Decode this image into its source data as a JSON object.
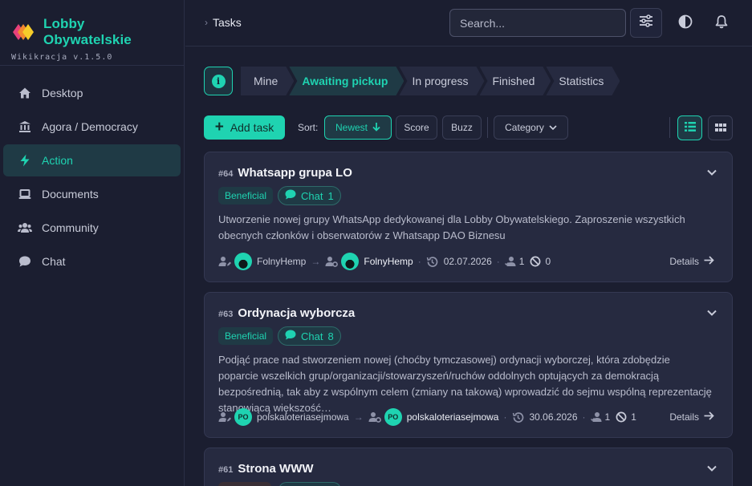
{
  "brand": {
    "name": "Lobby Obywatelskie",
    "version": "Wikikracja v.1.5.0"
  },
  "sidebar": {
    "items": [
      {
        "label": "Desktop",
        "icon": "home-icon"
      },
      {
        "label": "Agora / Democracy",
        "icon": "bank-icon"
      },
      {
        "label": "Action",
        "icon": "bolt-icon",
        "active": true
      },
      {
        "label": "Documents",
        "icon": "laptop-icon"
      },
      {
        "label": "Community",
        "icon": "users-icon"
      },
      {
        "label": "Chat",
        "icon": "chat-icon"
      }
    ]
  },
  "topbar": {
    "breadcrumb_sep": "›",
    "breadcrumb": "Tasks",
    "search_placeholder": "Search..."
  },
  "tabs": [
    {
      "label": "Mine"
    },
    {
      "label": "Awaiting pickup",
      "active": true
    },
    {
      "label": "In progress"
    },
    {
      "label": "Finished"
    },
    {
      "label": "Statistics"
    }
  ],
  "toolbar": {
    "add_label": "Add task",
    "sort_label": "Sort:",
    "sort_newest": "Newest",
    "sort_score": "Score",
    "sort_buzz": "Buzz",
    "category": "Category"
  },
  "tasks": [
    {
      "num": "#64",
      "title": "Whatsapp grupa LO",
      "tag": "Beneficial",
      "chat_label": "Chat",
      "chat_count": "1",
      "desc": "Utworzenie nowej grupy WhatsApp dedykowanej dla Lobby Obywatelskiego. Zaproszenie wszystkich obecnych członków i obserwatorów z  Whatsapp DAO Biznesu",
      "creator": "FolnyHemp",
      "assignee": "FolnyHemp",
      "date": "02.07.2026",
      "votes": "1",
      "blocks": "0",
      "details": "Details"
    },
    {
      "num": "#63",
      "title": "Ordynacja wyborcza",
      "tag": "Beneficial",
      "chat_label": "Chat",
      "chat_count": "8",
      "desc": "Podjąć prace nad stworzeniem nowej (choćby tymczasowej) ordynacji wyborczej, która zdobędzie poparcie wszelkich grup/organizacji/stowarzyszeń/ruchów oddolnych optujących za demokracją bezpośrednią, tak aby z wspólnym celem (zmiany na takową) wprowadzić do sejmu wspólną reprezentację stanowiącą większość…",
      "creator_avatar": "PO",
      "creator": "polskaloteriasejmowa",
      "assignee_avatar": "PO",
      "assignee": "polskaloteriasejmowa",
      "date": "30.06.2026",
      "votes": "1",
      "blocks": "1",
      "details": "Details"
    },
    {
      "num": "#61",
      "title": "Strona WWW"
    }
  ],
  "colors": {
    "accent": "#1fd3b1",
    "background": "#1b1e30",
    "card": "#262a40"
  }
}
